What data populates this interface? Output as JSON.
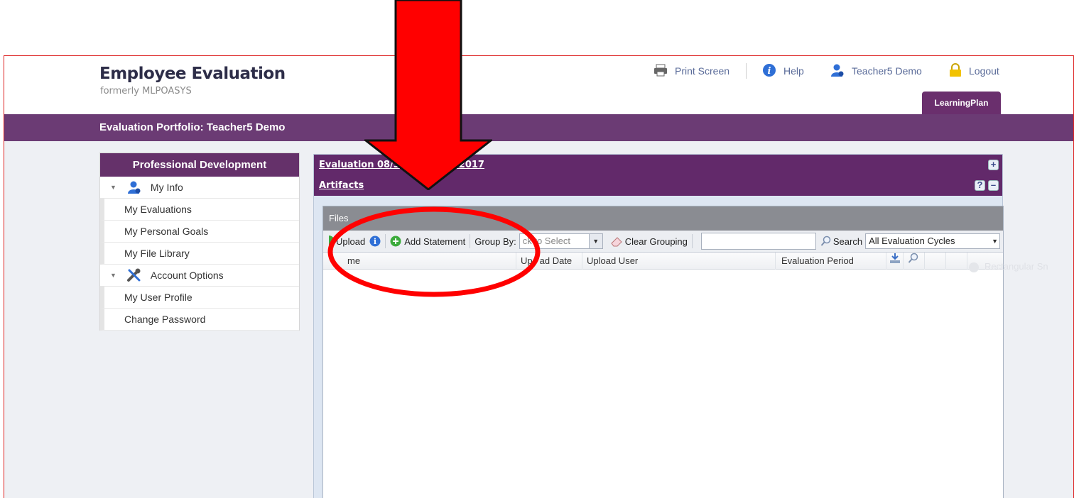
{
  "header": {
    "app_title": "Employee Evaluation",
    "app_subtitle": "formerly MLPOASYS",
    "print_label": "Print Screen",
    "help_label": "Help",
    "user_label": "Teacher5 Demo",
    "logout_label": "Logout",
    "tab_label": "LearningPlan"
  },
  "portfolio_bar": {
    "title": "Evaluation Portfolio: Teacher5 Demo"
  },
  "sidebar": {
    "heading": "Professional Development",
    "groups": [
      {
        "label": "My Info",
        "icon": "user-icon",
        "items": [
          "My Evaluations",
          "My Personal Goals",
          "My File Library"
        ]
      },
      {
        "label": "Account Options",
        "icon": "tools-icon",
        "items": [
          "My User Profile",
          "Change Password"
        ]
      }
    ]
  },
  "main": {
    "evaluation_link": "Evaluation 08/3",
    "evaluation_link_tail": "0/2017",
    "artifacts_link": "Artifacts",
    "ghost_text": "Rectangular Sn",
    "files": {
      "title": "Files",
      "toolbar": {
        "upload_label": "Upload",
        "add_statement_label": "Add Statement",
        "group_by_label": "Group By:",
        "group_by_value": "ck to Select",
        "clear_grouping_label": "Clear Grouping",
        "search_label": "Search",
        "cycle_value": "All Evaluation Cycles"
      },
      "columns": [
        "me",
        "Up",
        "ad Date",
        "Upload User",
        "Evaluation Period"
      ]
    }
  },
  "colors": {
    "purple_bar": "#6b3b74",
    "panel_purple": "#62296a",
    "annotation_red": "#ff0000"
  }
}
